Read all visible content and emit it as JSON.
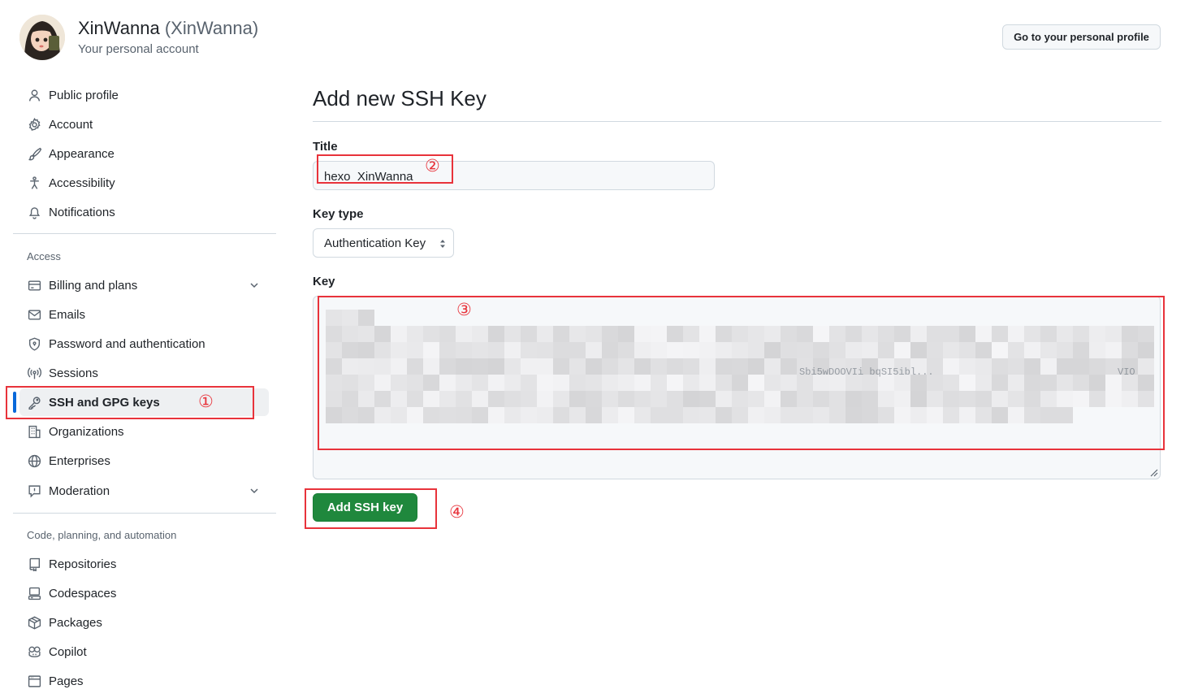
{
  "header": {
    "display_name": "XinWanna",
    "login": "(XinWanna)",
    "subtitle": "Your personal account",
    "profile_button": "Go to your personal profile"
  },
  "sidebar": {
    "items_top": [
      {
        "label": "Public profile",
        "icon": "person-icon"
      },
      {
        "label": "Account",
        "icon": "gear-icon"
      },
      {
        "label": "Appearance",
        "icon": "paintbrush-icon"
      },
      {
        "label": "Accessibility",
        "icon": "accessibility-icon"
      },
      {
        "label": "Notifications",
        "icon": "bell-icon"
      }
    ],
    "access_heading": "Access",
    "items_access": [
      {
        "label": "Billing and plans",
        "icon": "credit-card-icon"
      },
      {
        "label": "Emails",
        "icon": "mail-icon"
      },
      {
        "label": "Password and authentication",
        "icon": "shield-lock-icon"
      },
      {
        "label": "Sessions",
        "icon": "broadcast-icon"
      },
      {
        "label": "SSH and GPG keys",
        "icon": "key-icon"
      },
      {
        "label": "Organizations",
        "icon": "organization-icon"
      },
      {
        "label": "Enterprises",
        "icon": "globe-icon"
      },
      {
        "label": "Moderation",
        "icon": "report-icon"
      }
    ],
    "code_heading": "Code, planning, and automation",
    "items_code": [
      {
        "label": "Repositories",
        "icon": "repo-icon"
      },
      {
        "label": "Codespaces",
        "icon": "codespaces-icon"
      },
      {
        "label": "Packages",
        "icon": "package-icon"
      },
      {
        "label": "Copilot",
        "icon": "copilot-icon"
      },
      {
        "label": "Pages",
        "icon": "browser-icon"
      }
    ]
  },
  "main": {
    "title": "Add new SSH Key",
    "title_label": "Title",
    "title_value": "hexo_XinWanna",
    "key_type_label": "Key type",
    "key_type_value": "Authentication Key",
    "key_label": "Key",
    "key_partial_text": "Sbi5wDOOVIi bqSI5ibl...",
    "key_partial_tail": "VIO",
    "submit_label": "Add SSH key"
  },
  "annotations": {
    "step1": "①",
    "step2": "②",
    "step3": "③",
    "step4": "④",
    "color": "#e8333b"
  },
  "colors": {
    "accent": "#0969da",
    "primary_button": "#1f883d"
  }
}
